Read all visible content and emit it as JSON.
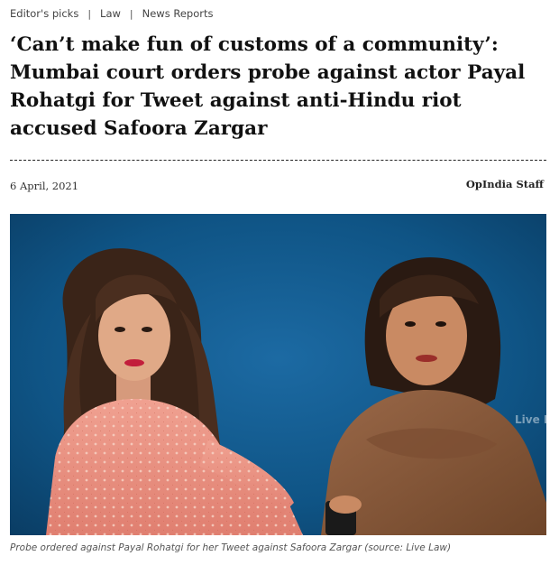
{
  "breadcrumbs": [
    {
      "label": "Editor's picks"
    },
    {
      "label": "Law"
    },
    {
      "label": "News Reports"
    }
  ],
  "article": {
    "headline": "‘Can’t make fun of customs of a community’: Mumbai court orders probe against actor Payal Rohatgi for Tweet against anti-Hindu riot accused Safoora Zargar",
    "date": "6 April, 2021",
    "author": "OpIndia Staff",
    "image_watermark": "Live Law",
    "caption": "Probe ordered against Payal Rohatgi for her Tweet against Safoora Zargar (source: Live Law)"
  },
  "colors": {
    "photo_background": "#0d4d7a",
    "left_outfit": "#e9907f",
    "right_shawl": "#8a5a3c"
  }
}
